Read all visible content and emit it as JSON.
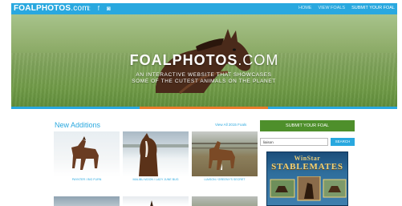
{
  "header": {
    "logo_main": "FOALPHOTOS",
    "logo_suffix": ".com",
    "social": [
      {
        "icon": "twitter-icon",
        "glyph": "𝕥"
      },
      {
        "icon": "facebook-icon",
        "glyph": "f"
      },
      {
        "icon": "instagram-icon",
        "glyph": "◙"
      }
    ],
    "nav": [
      {
        "label": "HOME",
        "active": false
      },
      {
        "label": "VIEW FOALS",
        "active": false
      },
      {
        "label": "SUBMIT YOUR FOAL",
        "active": true
      }
    ]
  },
  "hero": {
    "title_main": "FOALPHOTOS",
    "title_suffix": ".COM",
    "subtitle": "AN INTERACTIVE WEBSITE THAT SHOWCASES SOME OF THE CUTEST ANIMALS ON THE PLANET"
  },
  "new_additions": {
    "title": "New Additions",
    "view_all": "View All 2015 Foals",
    "items": [
      {
        "caption": "PAYNTER / BIG FURN"
      },
      {
        "caption": "MALIBU MOON / LADY JUNE BUG"
      },
      {
        "caption": "LIAISON / GREENY'S SECRET"
      }
    ]
  },
  "sidebar": {
    "submit_label": "SUBMIT YOUR FOAL",
    "search_value": "liaison",
    "search_button": "SEARCH",
    "ad_line1": "WinStar",
    "ad_line2": "STABLEMATES"
  },
  "colors": {
    "accent_blue": "#29a8df",
    "submit_green": "#4e8f2b",
    "hero_stripe_orange": "#e87c2a"
  }
}
